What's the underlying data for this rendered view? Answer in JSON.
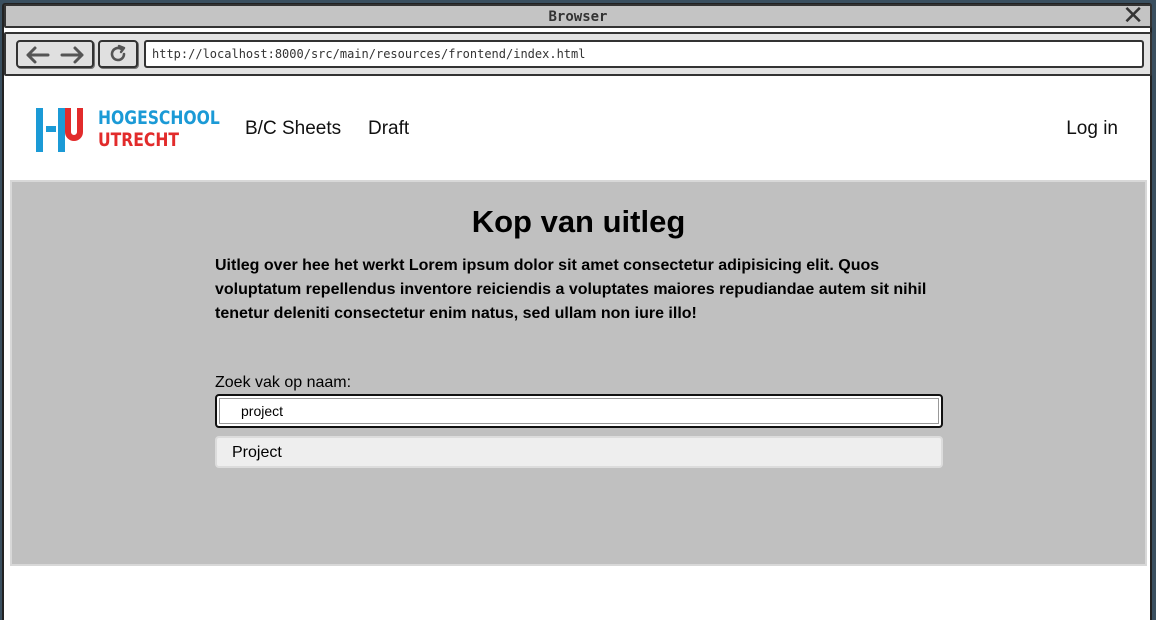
{
  "window": {
    "title": "Browser"
  },
  "toolbar": {
    "url": "http://localhost:8000/src/main/resources/frontend/index.html"
  },
  "header": {
    "logo": {
      "line1": "HOGESCHOOL",
      "line2": "UTRECHT"
    },
    "nav": [
      {
        "label": "B/C Sheets"
      },
      {
        "label": "Draft"
      }
    ],
    "login_label": "Log in"
  },
  "main": {
    "heading": "Kop van uitleg",
    "description": "Uitleg over hee het werkt Lorem ipsum dolor sit amet consectetur adipisicing elit. Quos voluptatum repellendus inventore reiciendis a voluptates maiores repudiandae autem sit nihil tenetur deleniti consectetur enim natus, sed ullam non iure illo!",
    "search": {
      "label": "Zoek vak op naam:",
      "value": "project"
    },
    "results": [
      {
        "label": "Project"
      }
    ]
  },
  "colors": {
    "logo_blue": "#1b9ad6",
    "logo_red": "#e22b2b",
    "panel_bg": "#c0c0c0",
    "result_bg": "#eeeeee"
  },
  "icons": [
    "close-icon",
    "back-arrow-icon",
    "forward-arrow-icon",
    "reload-icon",
    "hu-logo-icon"
  ]
}
